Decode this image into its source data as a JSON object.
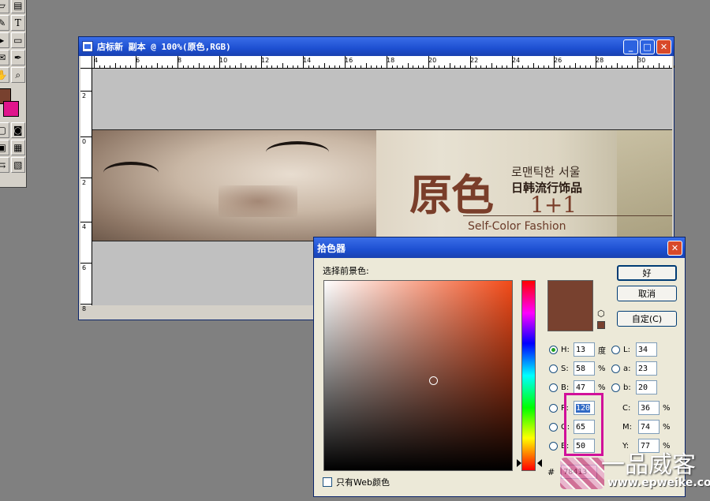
{
  "toolbox": {
    "tools": [
      "eraser-icon",
      "gradient-icon",
      "pen-icon",
      "type-icon",
      "path-select-icon",
      "shape-icon",
      "notes-icon",
      "eyedropper-icon",
      "hand-icon",
      "zoom-icon"
    ],
    "type_tool_label": "T",
    "foreground_color": "#78412f",
    "background_color": "#e0148c"
  },
  "document_window": {
    "title": "店标新 副本 @ 100%(原色,RGB)",
    "buttons": {
      "minimize": "_",
      "maximize": "□",
      "close": "✕"
    },
    "ruler_h_labels": [
      "4",
      "6",
      "8",
      "10",
      "12",
      "14",
      "16",
      "18",
      "20",
      "22",
      "24",
      "26",
      "28",
      "30"
    ],
    "ruler_v_labels": [
      "2",
      "0",
      "2",
      "4",
      "6",
      "8"
    ]
  },
  "banner": {
    "brand_name": "原色",
    "korean_text": "로맨틱한 서울",
    "chinese_subtitle": "日韩流行饰品",
    "number_text": "1+1",
    "english_text": "Self-Color Fashion"
  },
  "color_picker": {
    "title": "拾色器",
    "close": "✕",
    "label_select": "选择前景色:",
    "ok_button": "好",
    "cancel_button": "取消",
    "custom_button": "自定(C)",
    "cube_icon": "⬡",
    "current_color": "#78412f",
    "hsb": [
      {
        "label": "H:",
        "value": "13",
        "unit": "度",
        "selected": true
      },
      {
        "label": "S:",
        "value": "58",
        "unit": "%",
        "selected": false
      },
      {
        "label": "B:",
        "value": "47",
        "unit": "%",
        "selected": false
      }
    ],
    "rgb": [
      {
        "label": "R:",
        "value": "120",
        "selected": false
      },
      {
        "label": "G:",
        "value": "65",
        "selected": false
      },
      {
        "label": "B:",
        "value": "50",
        "selected": false
      }
    ],
    "lab": [
      {
        "label": "L:",
        "value": "34"
      },
      {
        "label": "a:",
        "value": "23"
      },
      {
        "label": "b:",
        "value": "20"
      }
    ],
    "cmyk": [
      {
        "label": "C:",
        "value": "36",
        "unit": "%"
      },
      {
        "label": "M:",
        "value": "74",
        "unit": "%"
      },
      {
        "label": "Y:",
        "value": "77",
        "unit": "%"
      }
    ],
    "hex_label": "#",
    "hex_value": "78413",
    "web_only_label": "只有Web颜色",
    "highlight_color": "#d1109a"
  },
  "watermark": {
    "logo_text": "一品威客",
    "url": "www.epweike.com"
  }
}
